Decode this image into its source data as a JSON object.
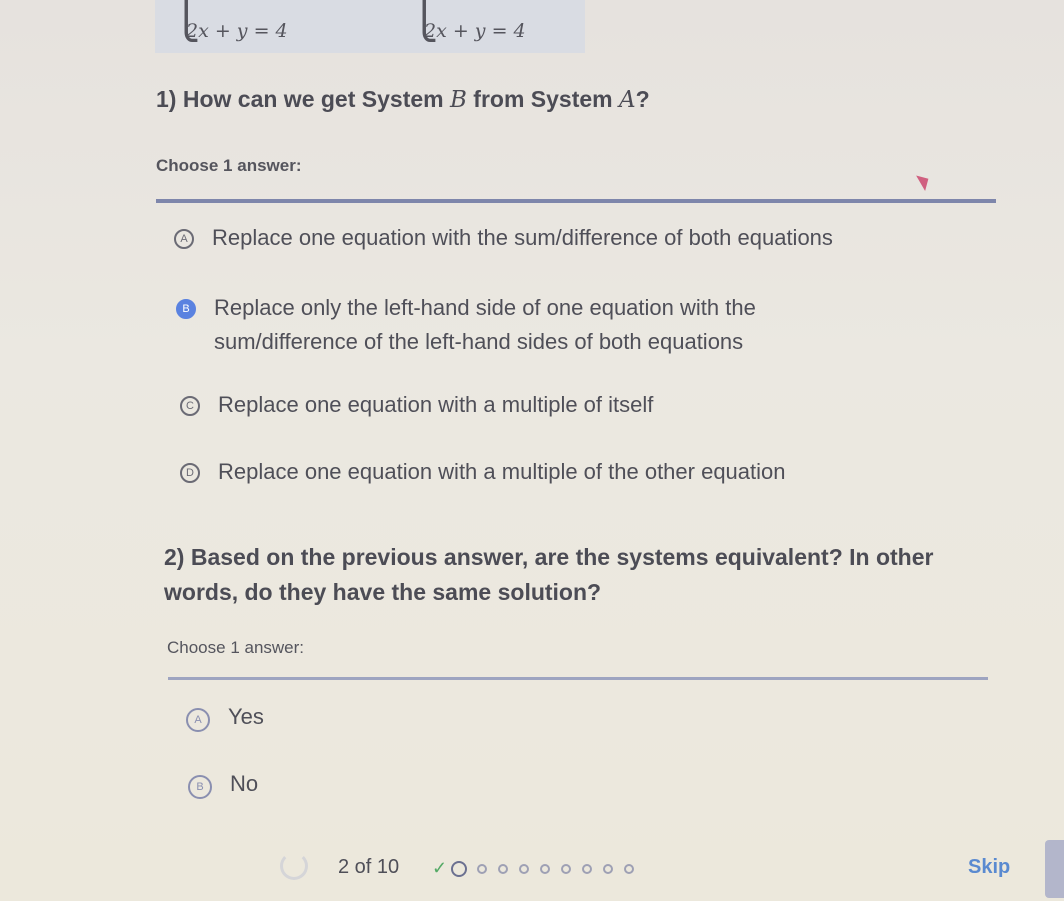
{
  "system_a": {
    "equation_visible": "2x + y = 4"
  },
  "system_b": {
    "equation_visible": "2x + y = 4"
  },
  "question1": {
    "number": "1)",
    "text_before": "How can we get System ",
    "math_b": "B",
    "text_mid": " from System ",
    "math_a": "A",
    "text_after": "?",
    "choose_label": "Choose 1 answer:",
    "options": [
      {
        "letter": "A",
        "text": "Replace one equation with the sum/difference of both equations",
        "selected": false
      },
      {
        "letter": "B",
        "text": "Replace only the left-hand side of one equation with the sum/difference of the left-hand sides of both equations",
        "selected": true
      },
      {
        "letter": "C",
        "text": "Replace one equation with a multiple of itself",
        "selected": false
      },
      {
        "letter": "D",
        "text": "Replace one equation with a multiple of the other equation",
        "selected": false
      }
    ]
  },
  "question2": {
    "text": "2) Based on the previous answer, are the systems equivalent? In other words, do they have the same solution?",
    "choose_label": "Choose 1 answer:",
    "options": [
      {
        "letter": "A",
        "text": "Yes",
        "selected": false
      },
      {
        "letter": "B",
        "text": "No",
        "selected": false
      }
    ]
  },
  "footer": {
    "progress_text": "2 of 10",
    "current_question": 2,
    "total_questions": 10,
    "completed_check": "✓",
    "skip_label": "Skip"
  }
}
